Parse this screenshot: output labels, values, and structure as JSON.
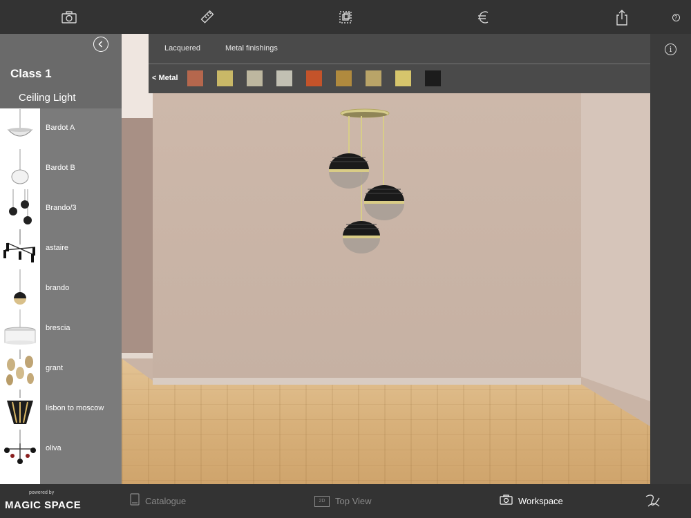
{
  "toolbar": {
    "icons": [
      "camera-icon",
      "ruler-icon",
      "duplicate-icon",
      "euro-icon",
      "share-icon",
      "help-icon"
    ],
    "help_label": "?"
  },
  "sidebar": {
    "class_title": "Class 1",
    "category_title": "Ceiling Light",
    "items": [
      {
        "label": "Bardot A"
      },
      {
        "label": "Bardot B"
      },
      {
        "label": "Brando/3"
      },
      {
        "label": "astaire"
      },
      {
        "label": "brando"
      },
      {
        "label": "brescia"
      },
      {
        "label": "grant"
      },
      {
        "label": "lisbon to moscow"
      },
      {
        "label": "oliva"
      }
    ]
  },
  "finish_panel": {
    "tabs": [
      {
        "label": "Lacquered"
      },
      {
        "label": "Metal finishings"
      }
    ],
    "back_label": "< Metal",
    "swatches": [
      {
        "name": "copper",
        "color": "#b5674d"
      },
      {
        "name": "brass",
        "color": "#c9b867"
      },
      {
        "name": "champagne",
        "color": "#bdb79f"
      },
      {
        "name": "silver",
        "color": "#c2c0b3"
      },
      {
        "name": "orange-copper",
        "color": "#c4532a"
      },
      {
        "name": "bronze",
        "color": "#b08a3e"
      },
      {
        "name": "antique-gold",
        "color": "#b9a468"
      },
      {
        "name": "gold",
        "color": "#d6c56c"
      },
      {
        "name": "black",
        "color": "#1c1c1c"
      }
    ],
    "info_label": "i"
  },
  "bottombar": {
    "powered_by": "powered by",
    "brand": "MAGIC SPACE",
    "nav": [
      {
        "label": "Catalogue",
        "icon": "catalogue-icon",
        "active": false
      },
      {
        "label": "Top View",
        "icon": "2d-icon",
        "active": false
      },
      {
        "label": "Workspace",
        "icon": "camera-icon",
        "active": true
      }
    ],
    "icon_2d": "2D",
    "logo_icon": "signature-logo-icon"
  }
}
